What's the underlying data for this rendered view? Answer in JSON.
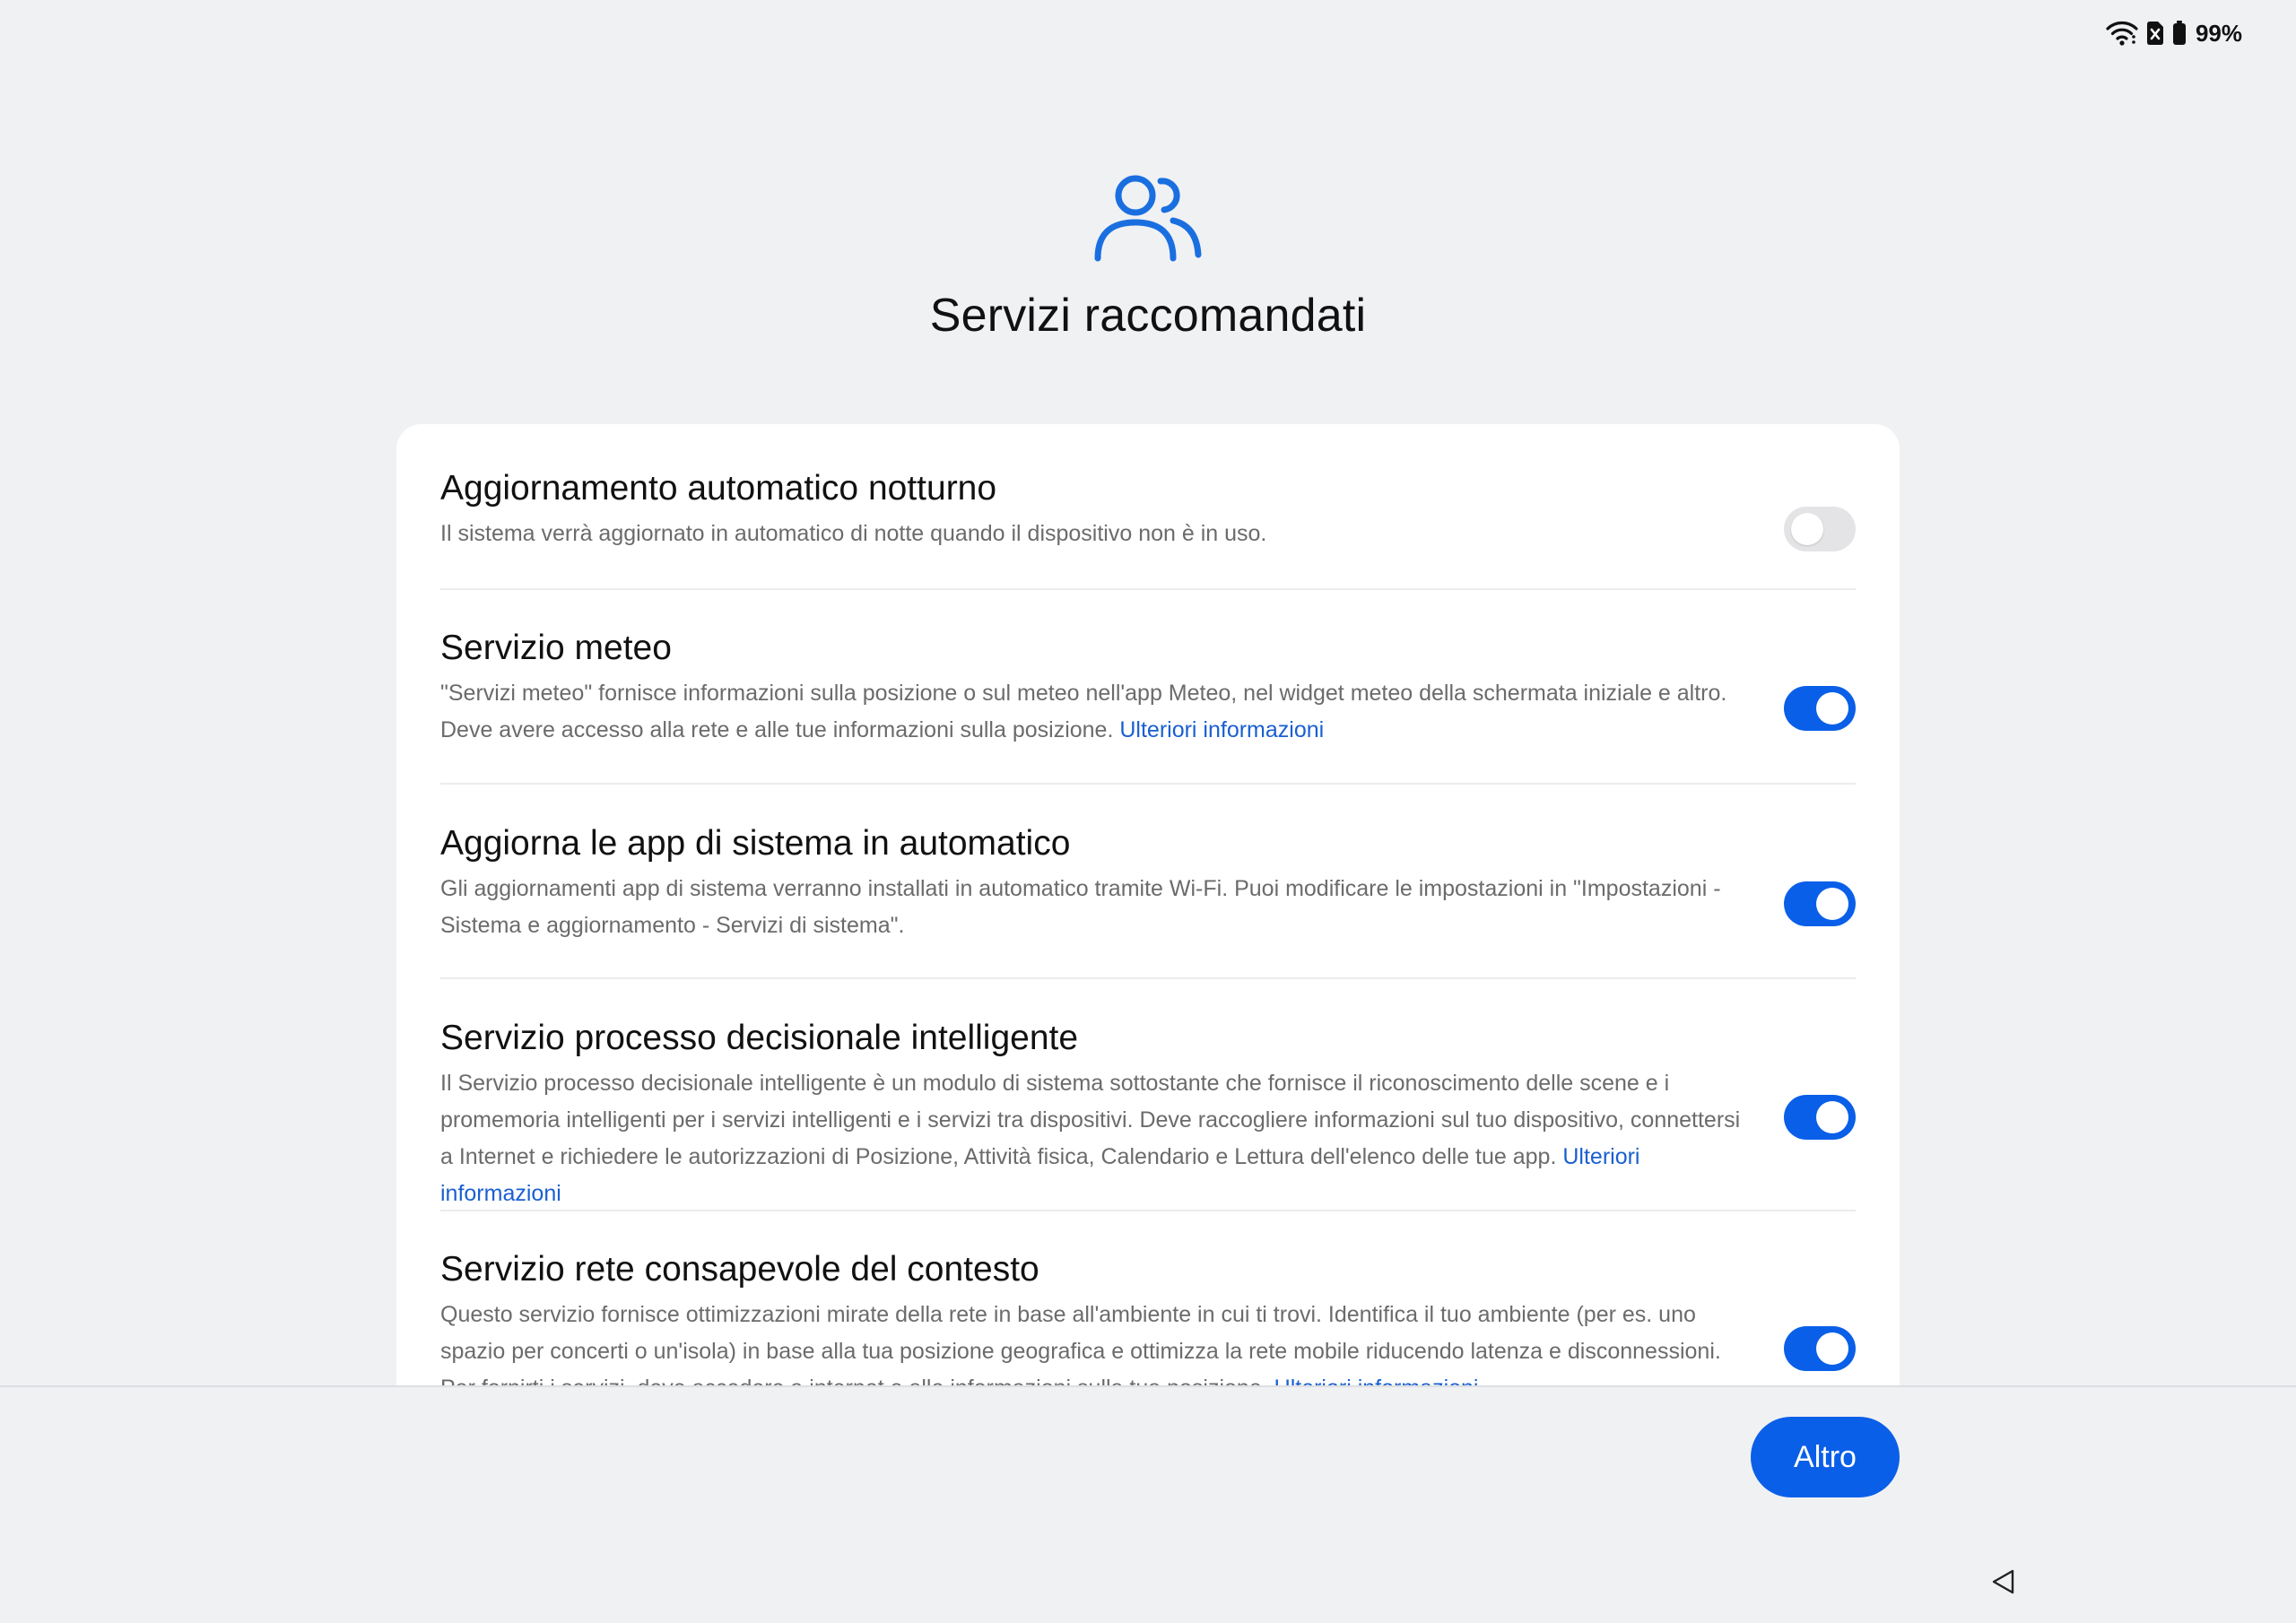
{
  "status_bar": {
    "icons": [
      "wifi-icon",
      "sim-off-icon",
      "battery-icon"
    ],
    "battery": "99%"
  },
  "header": {
    "icon": "users-icon",
    "title": "Servizi raccomandati"
  },
  "colors": {
    "accent": "#0a5fe8",
    "link": "#1a5fd1",
    "background": "#f0f1f3",
    "card": "#ffffff"
  },
  "services": [
    {
      "title": "Aggiornamento automatico notturno",
      "description": "Il sistema verrà aggiornato in automatico di notte quando il dispositivo non è in uso.",
      "link": "",
      "enabled": false
    },
    {
      "title": "Servizio meteo",
      "description": "\"Servizi meteo\" fornisce informazioni sulla posizione o sul meteo nell'app Meteo, nel widget meteo della schermata iniziale e altro. Deve avere accesso alla rete e alle tue informazioni sulla posizione.",
      "link": "Ulteriori informazioni",
      "enabled": true
    },
    {
      "title": "Aggiorna le app di sistema in automatico",
      "description": "Gli aggiornamenti app di sistema verranno installati in automatico tramite Wi-Fi. Puoi modificare le impostazioni in \"Impostazioni - Sistema e aggiornamento - Servizi di sistema\".",
      "link": "",
      "enabled": true
    },
    {
      "title": "Servizio processo decisionale intelligente",
      "description": "Il Servizio processo decisionale intelligente è un modulo di sistema sottostante che fornisce il riconoscimento delle scene e i promemoria intelligenti per i servizi intelligenti e i servizi tra dispositivi. Deve raccogliere informazioni sul tuo dispositivo, connettersi a Internet e richiedere le autorizzazioni di Posizione, Attività fisica, Calendario e Lettura dell'elenco delle tue app.",
      "link": "Ulteriori informazioni",
      "enabled": true
    },
    {
      "title": "Servizio rete consapevole del contesto",
      "description": "Questo servizio fornisce ottimizzazioni mirate della rete in base all'ambiente in cui ti trovi. Identifica il tuo ambiente (per es. uno spazio per concerti o un'isola) in base alla tua posizione geografica e ottimizza la rete mobile riducendo latenza e disconnessioni. Per fornirti i servizi, deve accedere a internet e alle informazioni sulla tua posizione.",
      "link": "Ulteriori informazioni",
      "enabled": true
    }
  ],
  "footer": {
    "next_label": "Altro",
    "nav_icon": "back-triangle-icon"
  }
}
